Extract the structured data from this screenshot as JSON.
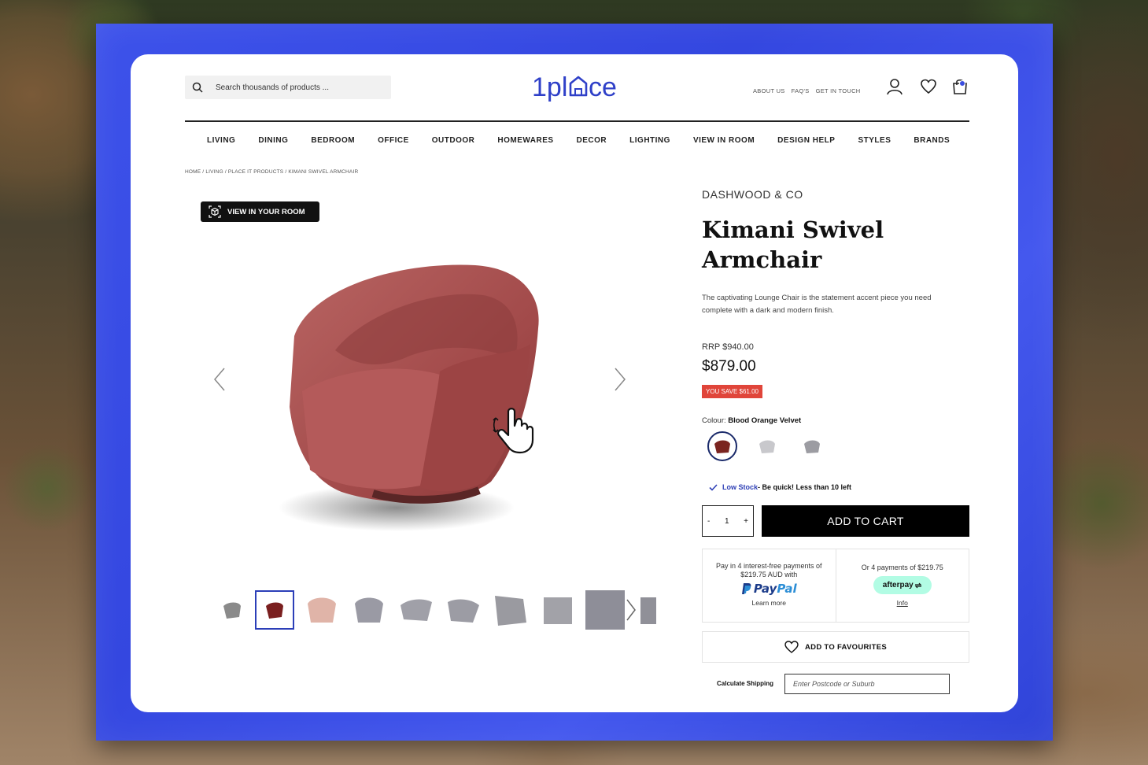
{
  "search": {
    "placeholder": "Search thousands of products ..."
  },
  "header": {
    "logo": "1place",
    "links": [
      "ABOUT US",
      "FAQ'S",
      "GET IN TOUCH"
    ],
    "cart_count": ""
  },
  "nav": {
    "items": [
      "LIVING",
      "DINING",
      "BEDROOM",
      "OFFICE",
      "OUTDOOR",
      "HOMEWARES",
      "DECOR",
      "LIGHTING",
      "VIEW IN ROOM",
      "DESIGN HELP",
      "STYLES",
      "BRANDS"
    ]
  },
  "breadcrumb": "HOME / LIVING / PLACE IT PRODUCTS / KIMANI SWIVEL ARMCHAIR",
  "gallery": {
    "view_in_room_label": "VIEW IN YOUR ROOM",
    "thumbnail_colors": [
      "#8a8a8a",
      "#7a1f1f",
      "#e0b4a8",
      "#9a9aa4",
      "#a0a0a8",
      "#9c9ca4",
      "#9a9aa0",
      "#a2a2a8",
      "#8e8e98",
      "#909098"
    ]
  },
  "product": {
    "brand": "DASHWOOD & CO",
    "title": "Kimani Swivel Armchair",
    "description": "The captivating Lounge Chair is the statement accent piece you need complete with a dark and modern finish.",
    "rrp": "RRP $940.00",
    "price": "$879.00",
    "save": "YOU SAVE $61.00",
    "colour_label": "Colour:",
    "colour_value": "Blood Orange Velvet",
    "swatches": [
      {
        "name": "Blood Orange Velvet",
        "color": "#7a2420",
        "selected": true
      },
      {
        "name": "Light Grey",
        "color": "#c8c8cc",
        "selected": false
      },
      {
        "name": "Dark Grey",
        "color": "#9c9ca2",
        "selected": false
      }
    ],
    "stock_status": "Low Stock",
    "stock_message": " - Be quick! Less than 10 left",
    "quantity": "1",
    "qty_minus": "-",
    "qty_plus": "+",
    "add_to_cart": "ADD TO CART"
  },
  "payments": {
    "paypal_text": "Pay in 4 interest-free payments of $219.75 AUD with",
    "paypal_brand_a": "Pay",
    "paypal_brand_b": "Pal",
    "paypal_link": "Learn more",
    "afterpay_text": "Or 4 payments of $219.75",
    "afterpay_brand": "afterpay",
    "afterpay_link": "Info"
  },
  "favourites_label": "ADD TO FAVOURITES",
  "shipping": {
    "label": "Calculate Shipping",
    "placeholder": "Enter Postcode or Suburb"
  },
  "colors": {
    "frame_blue": "#3a4de0",
    "logo_blue": "#2f40c8",
    "save_red": "#e0453a",
    "afterpay_mint": "#b2fce4"
  }
}
